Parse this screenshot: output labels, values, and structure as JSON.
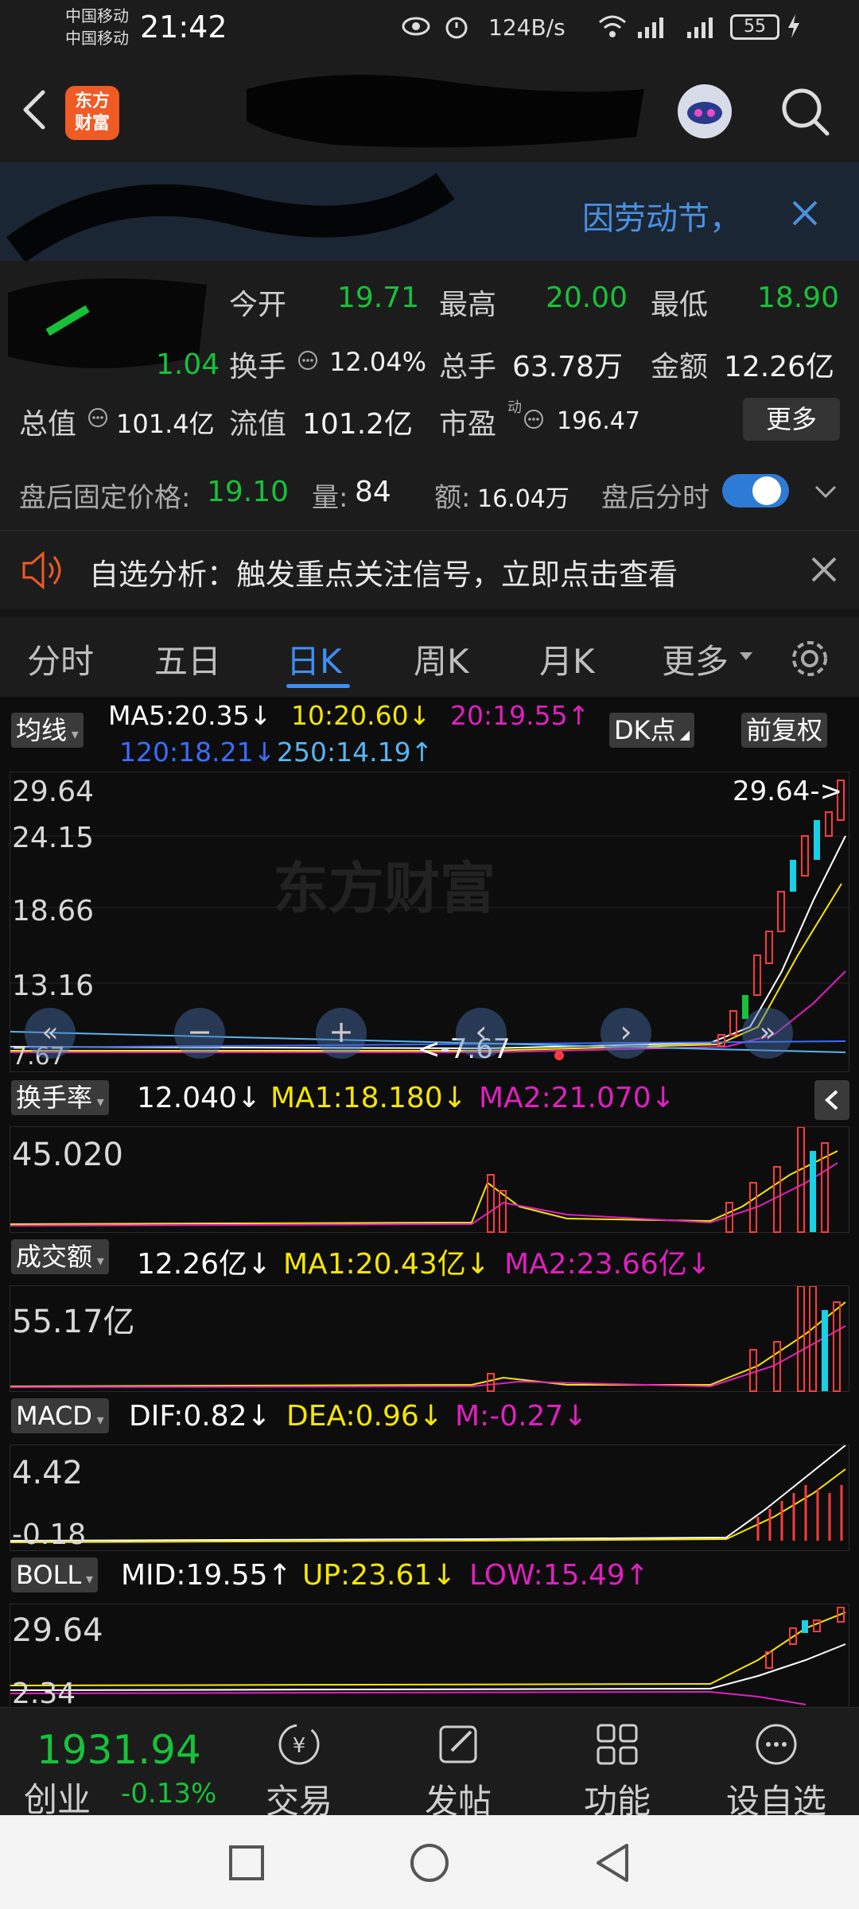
{
  "status_bar": {
    "carrier_1": "中国移动",
    "carrier_2": "中国移动",
    "time": "21:42",
    "net_speed": "124B/s",
    "battery": "55"
  },
  "header": {
    "logo_text": "东方\n财富",
    "logo_line1": "东方",
    "logo_line2": "财富"
  },
  "notice": {
    "text": "因劳动节，"
  },
  "quote": {
    "open_label": "今开",
    "open_value": "19.71",
    "high_label": "最高",
    "high_value": "20.00",
    "low_label": "最低",
    "low_value": "18.90",
    "change_value": "1.04",
    "turnover_label": "换手",
    "turnover_value": "12.04%",
    "volume_label": "总手",
    "volume_value": "63.78万",
    "amount_label": "金额",
    "amount_value": "12.26亿",
    "total_value_label": "总值",
    "total_value": "101.4亿",
    "float_value_label": "流值",
    "float_value": "101.2亿",
    "pe_label": "市盈",
    "pe_superscript": "动",
    "pe_value": "196.47",
    "more_button": "更多"
  },
  "after_hours": {
    "price_label": "盘后固定价格:",
    "price_value": "19.10",
    "volume_label": "量:",
    "volume_value": "84",
    "amount_label": "额:",
    "amount_value": "16.04万",
    "timeshare_label": "盘后分时",
    "toggle_on": true
  },
  "signal": {
    "text": "自选分析：触发重点关注信号，立即点击查看"
  },
  "tabs": {
    "items": [
      "分时",
      "五日",
      "日K",
      "周K",
      "月K",
      "更多"
    ],
    "active": "日K"
  },
  "kline": {
    "indicator_button": "均线",
    "ma5": "MA5:20.35↓",
    "ma10": "10:20.60↓",
    "ma20": "20:19.55↑",
    "ma120": "120:18.21↓",
    "ma250": "250:14.19↑",
    "dk_button": "DK点",
    "adjust_button": "前复权",
    "axis": [
      "29.64",
      "24.15",
      "18.66",
      "13.16",
      "7.67"
    ],
    "max_marker": "29.64->",
    "min_marker": "<-7.67",
    "watermark": "东方财富"
  },
  "turnover_panel": {
    "button": "换手率",
    "value": "12.040↓",
    "ma1": "MA1:18.180↓",
    "ma2": "MA2:21.070↓",
    "axis_top": "45.020"
  },
  "volume_panel": {
    "button": "成交额",
    "value": "12.26亿↓",
    "ma1": "MA1:20.43亿↓",
    "ma2": "MA2:23.66亿↓",
    "axis_top": "55.17亿"
  },
  "macd_panel": {
    "button": "MACD",
    "dif": "DIF:0.82↓",
    "dea": "DEA:0.96↓",
    "m": "M:-0.27↓",
    "axis_top": "4.42",
    "axis_bottom": "-0.18"
  },
  "boll_panel": {
    "button": "BOLL",
    "mid": "MID:19.55↑",
    "up": "UP:23.61↓",
    "low": "LOW:15.49↑",
    "axis_top": "29.64",
    "axis_bottom": "2.34"
  },
  "bottom_nav": {
    "index_value": "1931.94",
    "index_name": "创业",
    "index_change": "-0.13%",
    "items": [
      "交易",
      "发帖",
      "功能",
      "设自选"
    ]
  },
  "colors": {
    "up_red": "#ff3b3b",
    "down_green": "#17c23a",
    "ma_yellow": "#f5e600",
    "ma_magenta": "#e020c0",
    "ma_blue": "#3b6cff",
    "ma_lightblue": "#5ab4f0",
    "accent_blue": "#3e8ef7",
    "brand_orange": "#f05a24"
  }
}
